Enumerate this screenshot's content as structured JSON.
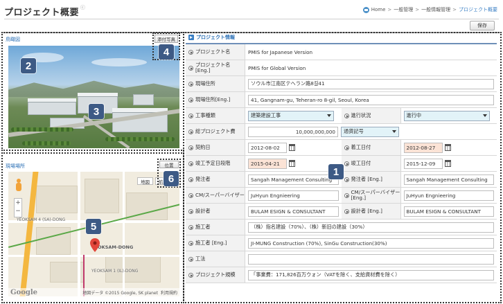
{
  "header": {
    "title": "プロジェクト概要",
    "title_sup": "ⓒ",
    "breadcrumb": [
      "Home",
      "一般管理",
      "一般情報管理",
      "プロジェクト概要"
    ],
    "save_label": "保存"
  },
  "left": {
    "bird_view_label": "鳥瞰図",
    "photo_button": "添付写真",
    "location_label": "現場場所",
    "position_button": "位置",
    "map": {
      "type_buttons": [
        "地図",
        "航"
      ],
      "labels": [
        "GEUMCHEON-DONG",
        "YEOKSAM-DONG",
        "YEOKSAM 1(IL)-DONG",
        "Sa-Dong",
        "Yeoksam"
      ],
      "zoom": [
        "+",
        "−"
      ],
      "logo": "Google",
      "attribution": "地図データ ©2015 Google, SK planet",
      "terms": "利用規約",
      "side_labels": [
        "YEOKSAM 4 (SA)-DONG",
        "YEOKSAM-DONG",
        "YEOKSAM 1 (IL)-DONG"
      ]
    }
  },
  "form": {
    "section_title": "プロジェクト情報",
    "rows": {
      "project_name": {
        "label": "プロジェクト名",
        "value": "PMIS for Japanese Version"
      },
      "project_name_en": {
        "label": "プロジェクト名[Eng.]",
        "value": "PMIS for Global Version"
      },
      "site_address": {
        "label": "現場住所",
        "value": "ソウル市江南区テヘラン路8길41"
      },
      "site_address_en": {
        "label": "現場住所[Eng.]",
        "value": "41, Gangnam-gu, Teheran-ro 8-gil, Seoul, Korea"
      },
      "work_type": {
        "label": "工事種類",
        "value": "建築建設工事"
      },
      "progress": {
        "label": "進行状況",
        "value": "進行中"
      },
      "project_cost": {
        "label": "総プロジェクト費",
        "value": "10,000,000,000",
        "currency": "通貨記号"
      },
      "contract_date": {
        "label": "契約日",
        "value": "2012-08-02"
      },
      "start_date": {
        "label": "着工日付",
        "value": "2012-08-27"
      },
      "completion_plan": {
        "label": "竣工予定日段階",
        "value": "2015-04-21"
      },
      "completion_date": {
        "label": "竣工日付",
        "value": "2015-12-09"
      },
      "client": {
        "label": "発注者",
        "value": "Sangah Management Consulting"
      },
      "client_en": {
        "label": "発注者 [Eng.]",
        "value": "Sangah Management Consulting"
      },
      "cm_supervisor": {
        "label": "CM/スーパーバイザー",
        "value": "JuHyun Engnieering"
      },
      "cm_supervisor_en": {
        "label": "CM/スーパーバイザー [Eng.]",
        "value": "JuHyun Engnieering"
      },
      "designer": {
        "label": "設計者",
        "value": "BULAM ESIGN & CONSULTANT"
      },
      "designer_en": {
        "label": "設計者 [Eng.]",
        "value": "BULAM ESIGN & CONSULTANT"
      },
      "builder": {
        "label": "施工者",
        "value": "（株）指名建設（70%）、（株）新旧の建設（30%）"
      },
      "builder_en": {
        "label": "施工者 [Eng.]",
        "value": "JI-MUNG Construction (70%), SinGu Construction(30%)"
      },
      "method": {
        "label": "工法",
        "value": ""
      },
      "scale": {
        "label": "プロジェクト規模",
        "value": "「事業費：171,826百万ウォン（VATを除く、支給資材費を除く）"
      }
    }
  },
  "badges": [
    "1",
    "2",
    "3",
    "4",
    "5",
    "6"
  ],
  "colors": {
    "accent": "#2a6fb5",
    "badge": "#3d5a85",
    "pink_input": "#fbe3d6",
    "select_bg": "#e2f3f8"
  }
}
